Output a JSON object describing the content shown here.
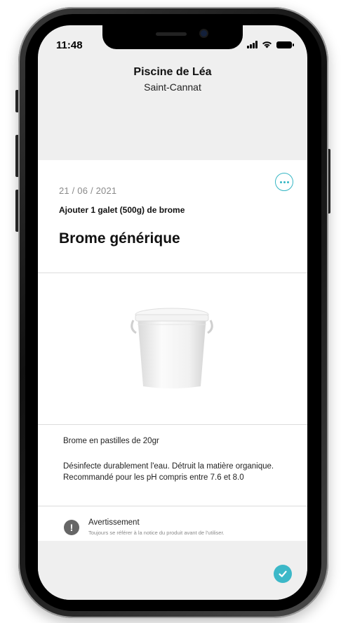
{
  "status_bar": {
    "time": "11:48"
  },
  "header": {
    "title": "Piscine de Léa",
    "subtitle": "Saint-Cannat"
  },
  "card": {
    "date": "21 / 06 / 2021",
    "action": "Ajouter 1 galet (500g) de brome",
    "product_name": "Brome générique",
    "description_short": "Brome en pastilles de 20gr",
    "description_long": "Désinfecte durablement l'eau. Détruit la matière organique. Recommandé pour les pH compris entre 7.6 et 8.0",
    "warning": {
      "icon_glyph": "!",
      "title": "Avertissement",
      "text": "Toujours se référer à la notice du produit avant de l'utiliser."
    }
  },
  "icons": {
    "more": "more-options-icon",
    "confirm": "checkmark-icon",
    "warning": "exclamation-icon",
    "product": "bucket-image"
  },
  "colors": {
    "accent": "#35b6c4",
    "confirm": "#3cb8c8",
    "background": "#efefef",
    "card": "#ffffff"
  }
}
